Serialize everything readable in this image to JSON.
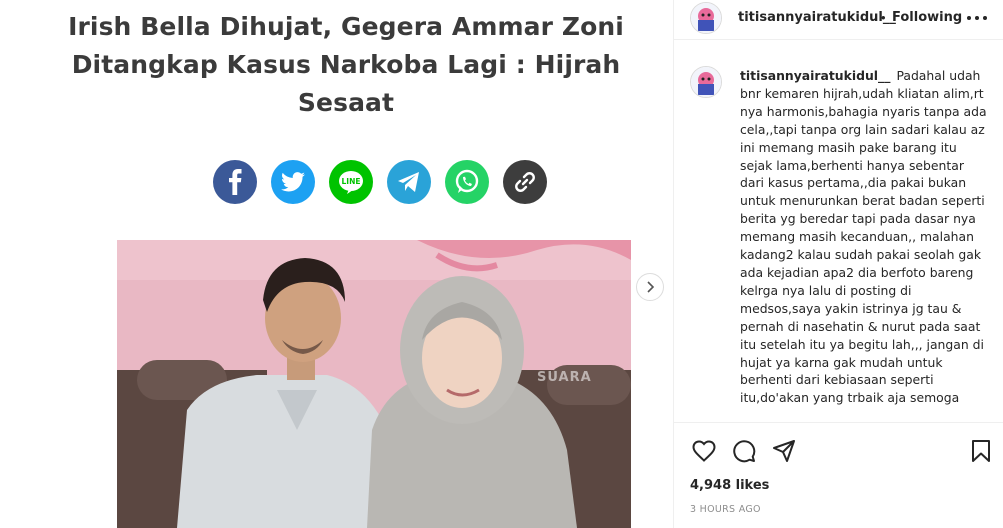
{
  "post": {
    "headline_lines": [
      "Irish Bella Dihujat, Gegera Ammar Zoni",
      "Ditangkap Kasus Narkoba Lagi : Hijrah",
      "Sesaat"
    ],
    "share_icons": [
      {
        "name": "facebook-icon",
        "color": "#3b5998"
      },
      {
        "name": "twitter-icon",
        "color": "#1da1f2"
      },
      {
        "name": "line-icon",
        "color": "#00c300",
        "label": "LINE"
      },
      {
        "name": "telegram-icon",
        "color": "#2aa3d8"
      },
      {
        "name": "whatsapp-icon",
        "color": "#25d366"
      },
      {
        "name": "link-icon",
        "color": "#3d3d3d"
      }
    ],
    "photo_watermark": "SUARA",
    "next_icon": "chevron-right-icon"
  },
  "header": {
    "username": "titisannyairatukidul__",
    "separator": "•",
    "follow_label": "Following",
    "more_icon": "more-horizontal-icon"
  },
  "caption": {
    "username": "titisannyairatukidul__",
    "text": "Padahal udah bnr kemaren hijrah,udah kliatan alim,rt nya harmonis,bahagia nyaris tanpa ada cela,,tapi tanpa org lain sadari kalau az ini memang masih pake barang itu sejak lama,berhenti hanya sebentar dari kasus pertama,,dia pakai bukan untuk menurunkan berat badan seperti berita yg beredar tapi pada dasar nya memang masih kecanduan,, malahan kadang2 kalau sudah pakai seolah gak ada kejadian apa2 dia berfoto bareng kelrga nya lalu di posting di medsos,saya yakin istrinya jg tau & pernah di nasehatin & nurut pada saat itu setelah itu ya begitu lah,,, jangan di hujat ya karna gak mudah untuk berhenti dari kebiasaan seperti itu,do'akan yang trbaik aja semoga"
  },
  "actions": {
    "like_icon": "heart-icon",
    "comment_icon": "comment-icon",
    "share_icon": "send-icon",
    "save_icon": "bookmark-icon"
  },
  "likes_text": "4,948 likes",
  "time_text": "3 HOURS AGO"
}
